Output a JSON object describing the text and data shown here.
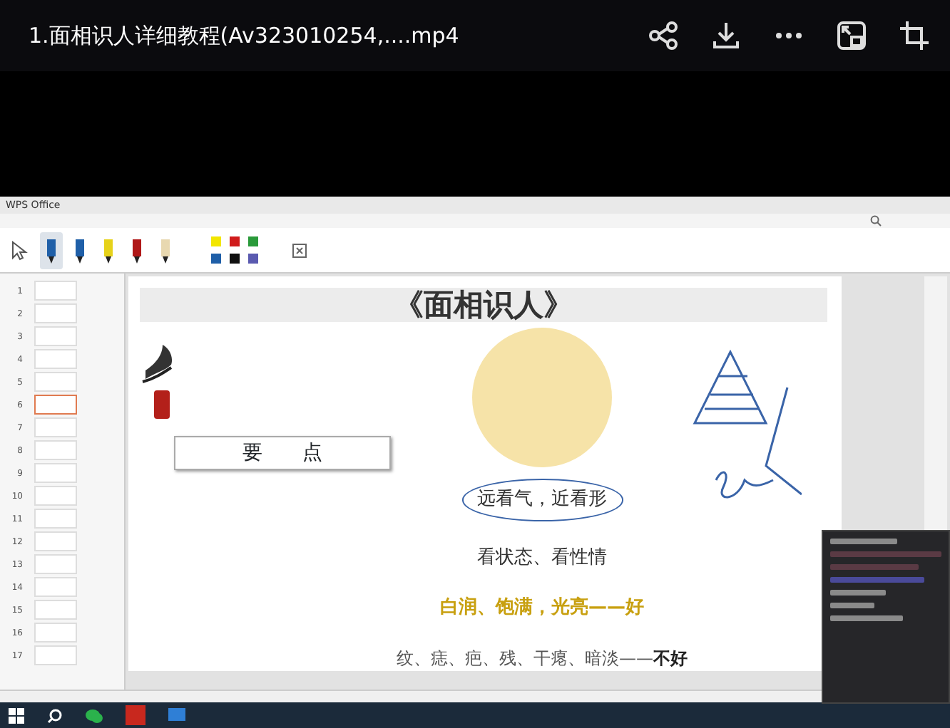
{
  "video": {
    "title": "1.面相识人详细教程(Av323010254,....mp4"
  },
  "app_tabs": [
    {
      "label": "WPS Office",
      "selected": false
    }
  ],
  "pen_tools": [
    {
      "color": "#1f5fa8",
      "selected": true
    },
    {
      "color": "#1f5fa8",
      "selected": false
    },
    {
      "color": "#e6d21a",
      "selected": false
    },
    {
      "color": "#b01818",
      "selected": false
    },
    {
      "color": "#e8d8b0",
      "selected": false
    }
  ],
  "swatches": [
    {
      "color": "#f2e600"
    },
    {
      "color": "#d01c1c"
    },
    {
      "color": "#2a9a3a"
    },
    {
      "color": "#1f5fa8"
    },
    {
      "color": "#111111"
    },
    {
      "color": "#5a5ab0"
    }
  ],
  "thumbnails": [
    {
      "number": "1",
      "selected": false
    },
    {
      "number": "2",
      "selected": false
    },
    {
      "number": "3",
      "selected": false
    },
    {
      "number": "4",
      "selected": false
    },
    {
      "number": "5",
      "selected": false
    },
    {
      "number": "6",
      "selected": true
    },
    {
      "number": "7",
      "selected": false
    },
    {
      "number": "8",
      "selected": false
    },
    {
      "number": "9",
      "selected": false
    },
    {
      "number": "10",
      "selected": false
    },
    {
      "number": "11",
      "selected": false
    },
    {
      "number": "12",
      "selected": false
    },
    {
      "number": "13",
      "selected": false
    },
    {
      "number": "14",
      "selected": false
    },
    {
      "number": "15",
      "selected": false
    },
    {
      "number": "16",
      "selected": false
    },
    {
      "number": "17",
      "selected": false
    }
  ],
  "slide": {
    "title": "《面相识人》",
    "key_points": "要　　点",
    "lines": [
      {
        "text": "远看气，近看形",
        "kind": "circled"
      },
      {
        "text": "看状态、看性情",
        "kind": "plain"
      },
      {
        "text": "白润、饱满，光亮——好",
        "kind": "good"
      },
      {
        "text": "纹、痣、疤、残、干瘪、暗淡——**不好**",
        "kind": "bad"
      }
    ]
  }
}
